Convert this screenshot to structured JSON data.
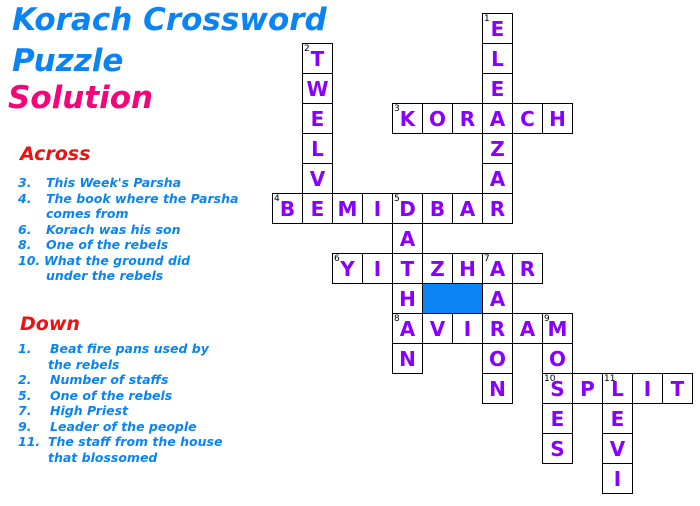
{
  "title": {
    "line1": "Korach Crossword",
    "line2": "Puzzle",
    "line3": "Solution"
  },
  "across": {
    "heading": "Across",
    "clues": [
      {
        "num": "3.",
        "text": "This Week's Parsha",
        "cont": ""
      },
      {
        "num": "4.",
        "text": "The book where the Parsha",
        "cont": "comes from"
      },
      {
        "num": "6.",
        "text": "Korach was his son",
        "cont": ""
      },
      {
        "num": "8.",
        "text": "One of the rebels",
        "cont": ""
      },
      {
        "num": "10.",
        "text": "What the ground did",
        "cont": "under the rebels"
      }
    ]
  },
  "down": {
    "heading": "Down",
    "clues": [
      {
        "num": "1.",
        "text": "Beat fire pans used by",
        "cont": "the rebels"
      },
      {
        "num": "2.",
        "text": "Number of staffs",
        "cont": ""
      },
      {
        "num": "5.",
        "text": "One of the rebels",
        "cont": ""
      },
      {
        "num": "7.",
        "text": "High Priest",
        "cont": ""
      },
      {
        "num": "9.",
        "text": "Leader of the people",
        "cont": ""
      },
      {
        "num": "11.",
        "text": "The staff from the house",
        "cont": "that blossomed"
      }
    ]
  },
  "answers": [
    {
      "num": 1,
      "dir": "down",
      "word": "ELEAZAR",
      "row": 0,
      "col": 7
    },
    {
      "num": 2,
      "dir": "down",
      "word": "TWELVE",
      "row": 1,
      "col": 1
    },
    {
      "num": 3,
      "dir": "across",
      "word": "KORACH",
      "row": 3,
      "col": 4
    },
    {
      "num": 4,
      "dir": "across",
      "word": "BEMIDBAR",
      "row": 6,
      "col": 0
    },
    {
      "num": 5,
      "dir": "down",
      "word": "DATHAN",
      "row": 6,
      "col": 4
    },
    {
      "num": 6,
      "dir": "across",
      "word": "YITZHAR",
      "row": 8,
      "col": 2
    },
    {
      "num": 7,
      "dir": "down",
      "word": "AARON",
      "row": 8,
      "col": 7
    },
    {
      "num": 8,
      "dir": "across",
      "word": "AVIRAM",
      "row": 10,
      "col": 4
    },
    {
      "num": 9,
      "dir": "down",
      "word": "MOSES",
      "row": 10,
      "col": 9
    },
    {
      "num": 10,
      "dir": "across",
      "word": "SPLIT",
      "row": 12,
      "col": 9
    },
    {
      "num": 11,
      "dir": "down",
      "word": "LEVI",
      "row": 12,
      "col": 11
    }
  ],
  "colors": {
    "title": "#0a84f4",
    "solution": "#f4057a",
    "heading": "#ee1111",
    "letters": "#8a00ff",
    "fill": "#0a84f4"
  }
}
